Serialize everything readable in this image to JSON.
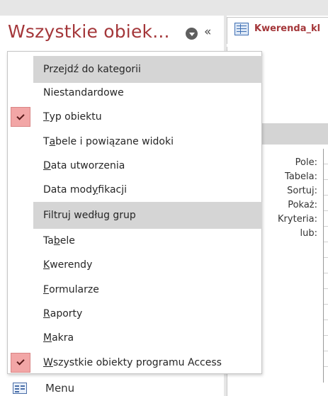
{
  "nav_pane": {
    "title": "Wszystkie obiek...",
    "collapse_glyph": "«",
    "bottom_item": {
      "label": "Menu",
      "icon": "form-icon"
    }
  },
  "document": {
    "tab_label": "Kwerenda_kl",
    "tab_icon": "query-icon",
    "grid_row_labels": [
      "Pole:",
      "Tabela:",
      "Sortuj:",
      "Pokaż:",
      "Kryteria:",
      "lub:"
    ]
  },
  "dropdown": {
    "section_category": "Przejdź do kategorii",
    "section_filter": "Filtruj według grup",
    "category_items": [
      {
        "pre": "Niestandardowe",
        "key": "",
        "post": "",
        "checked": false
      },
      {
        "pre": "",
        "key": "T",
        "post": "yp obiektu",
        "checked": true
      },
      {
        "pre": "T",
        "key": "a",
        "post": "bele i powiązane widoki",
        "checked": false
      },
      {
        "pre": "",
        "key": "D",
        "post": "ata utworzenia",
        "checked": false
      },
      {
        "pre": "Data mod",
        "key": "y",
        "post": "fikacji",
        "checked": false
      }
    ],
    "filter_items": [
      {
        "pre": "Ta",
        "key": "b",
        "post": "ele",
        "checked": false
      },
      {
        "pre": "",
        "key": "K",
        "post": "werendy",
        "checked": false
      },
      {
        "pre": "",
        "key": "F",
        "post": "ormularze",
        "checked": false
      },
      {
        "pre": "",
        "key": "R",
        "post": "aporty",
        "checked": false
      },
      {
        "pre": "",
        "key": "M",
        "post": "akra",
        "checked": false
      },
      {
        "pre": "",
        "key": "W",
        "post": "szystkie obiekty programu Access",
        "checked": true
      }
    ]
  },
  "colors": {
    "accent": "#a4373a",
    "section_bg": "#d5d5d5",
    "check_bg": "#f2a6a6",
    "chrome_gray": "#e6e6e6"
  }
}
